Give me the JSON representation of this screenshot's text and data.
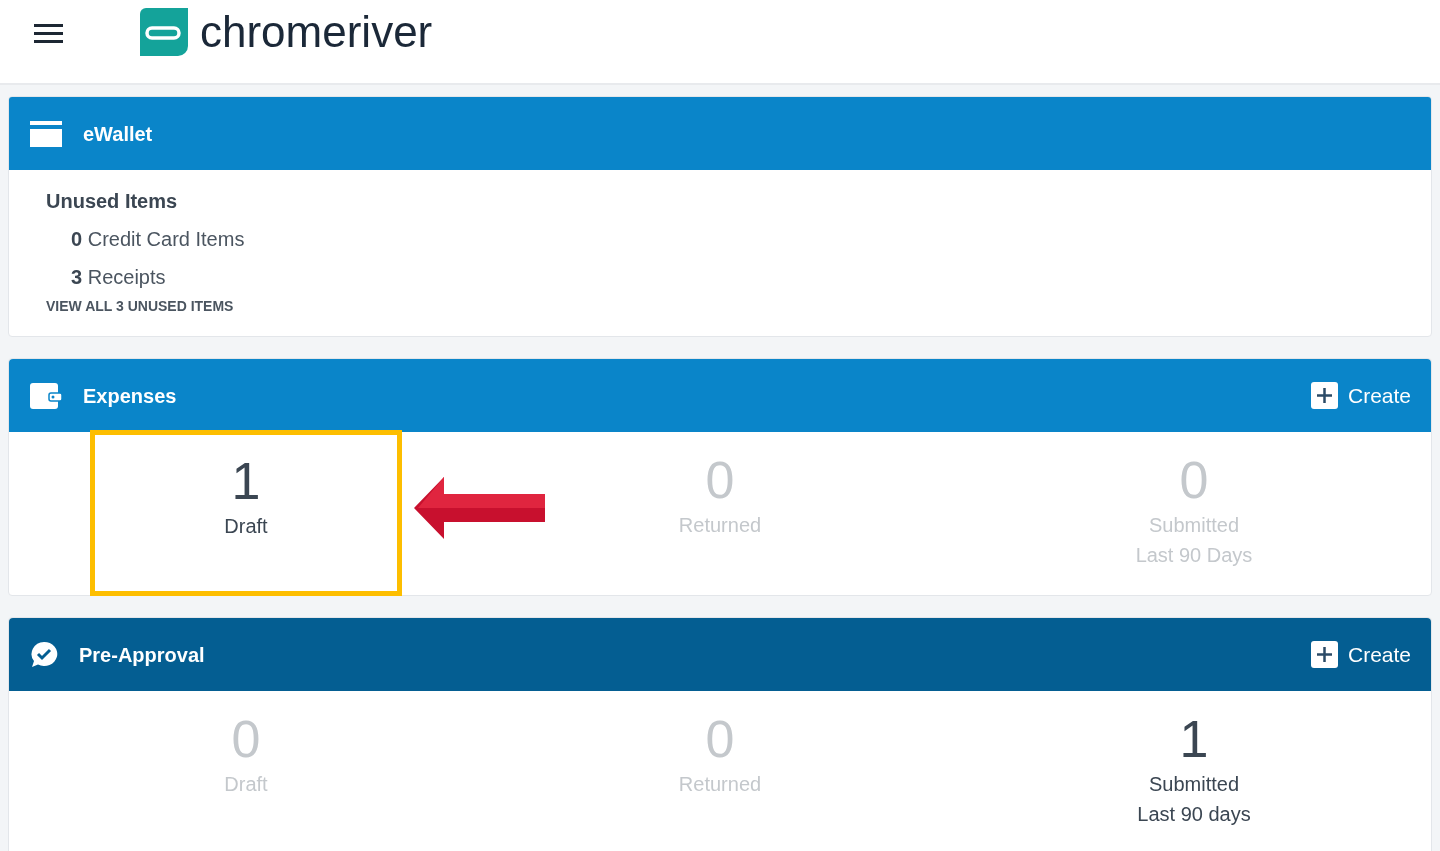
{
  "header": {
    "logo_text": "chromeriver"
  },
  "ewallet": {
    "title": "eWallet",
    "section_title": "Unused Items",
    "items": [
      {
        "count": "0",
        "label": "Credit Card Items"
      },
      {
        "count": "3",
        "label": "Receipts"
      }
    ],
    "link": "VIEW ALL 3 UNUSED ITEMS"
  },
  "panels": [
    {
      "kind": "expenses",
      "title": "Expenses",
      "action": "Create",
      "stats": [
        {
          "count": "1",
          "lines": [
            "Draft"
          ],
          "muted": false,
          "highlighted": true
        },
        {
          "count": "0",
          "lines": [
            "Returned"
          ],
          "muted": true,
          "highlighted": false
        },
        {
          "count": "0",
          "lines": [
            "Submitted",
            "Last 90 Days"
          ],
          "muted": true,
          "highlighted": false
        }
      ]
    },
    {
      "kind": "pre-approval",
      "title": "Pre-Approval",
      "action": "Create",
      "stats": [
        {
          "count": "0",
          "lines": [
            "Draft"
          ],
          "muted": true,
          "highlighted": false
        },
        {
          "count": "0",
          "lines": [
            "Returned"
          ],
          "muted": true,
          "highlighted": false
        },
        {
          "count": "1",
          "lines": [
            "Submitted",
            "Last 90 days"
          ],
          "muted": false,
          "highlighted": false
        }
      ]
    }
  ]
}
